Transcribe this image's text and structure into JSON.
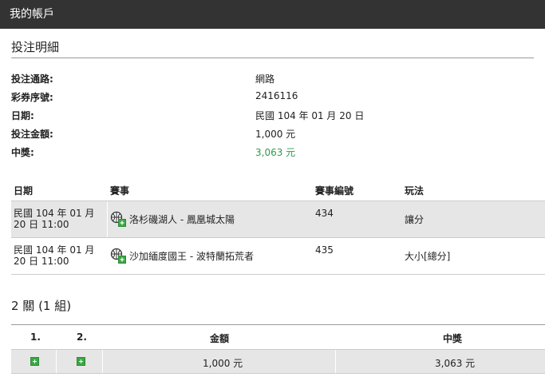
{
  "header": {
    "title": "我的帳戶"
  },
  "details": {
    "title": "投注明細",
    "rows": [
      {
        "label": "投注通路:",
        "value": "網路"
      },
      {
        "label": "彩券序號:",
        "value": "2416116"
      },
      {
        "label": "日期:",
        "value": "民國 104 年 01 月 20 日"
      },
      {
        "label": "投注金額:",
        "value": "1,000 元"
      },
      {
        "label": "中獎:",
        "value": "3,063 元"
      }
    ]
  },
  "bets": {
    "headers": {
      "date": "日期",
      "event": "賽事",
      "code": "賽事編號",
      "play": "玩法"
    },
    "rows": [
      {
        "date_line1": "民國 104 年 01 月",
        "date_line2": "20 日 11:00",
        "event": "洛杉磯湖人 - 鳳凰城太陽",
        "code": "434",
        "play": "讓分"
      },
      {
        "date_line1": "民國 104 年 01 月",
        "date_line2": "20 日 11:00",
        "event": "沙加緬度國王 - 波特蘭拓荒者",
        "code": "435",
        "play": "大小[總分]"
      }
    ]
  },
  "combo": {
    "title": "2 關 (1 組)",
    "headers": {
      "c1": "1.",
      "c2": "2.",
      "amount": "金額",
      "win": "中獎"
    },
    "row": {
      "amount": "1,000 元",
      "win": "3,063 元"
    }
  },
  "colors": {
    "topbar": "#333333",
    "win": "#2a9d4a",
    "plus": "#3aa845",
    "shade": "#e6e6e6"
  },
  "icons": {
    "sport": "basketball-icon",
    "expand": "plus-icon"
  }
}
